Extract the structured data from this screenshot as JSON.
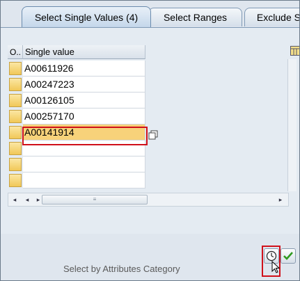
{
  "tabs": [
    {
      "label": "Select Single Values (4)",
      "active": true
    },
    {
      "label": "Select Ranges",
      "active": false
    },
    {
      "label": "Exclude Si",
      "active": false
    }
  ],
  "table": {
    "columns": [
      "O..",
      "Single value"
    ],
    "rows": [
      "A00611926",
      "A00247223",
      "A00126105",
      "A00257170",
      "A00141914",
      "",
      "",
      ""
    ],
    "selected_row_index": 4
  },
  "footer_text": "Select by Attributes Category",
  "colors": {
    "row_selector": "#f1c858",
    "highlight": "#f7d27a",
    "callout": "#d0101a",
    "accent": "#6a8bad"
  },
  "icons": {
    "table_settings": "table-settings-icon",
    "multiple_selection": "multiple-selection-icon",
    "execute": "clock-icon",
    "confirm": "check-icon",
    "cursor": "mouse-pointer-icon"
  }
}
